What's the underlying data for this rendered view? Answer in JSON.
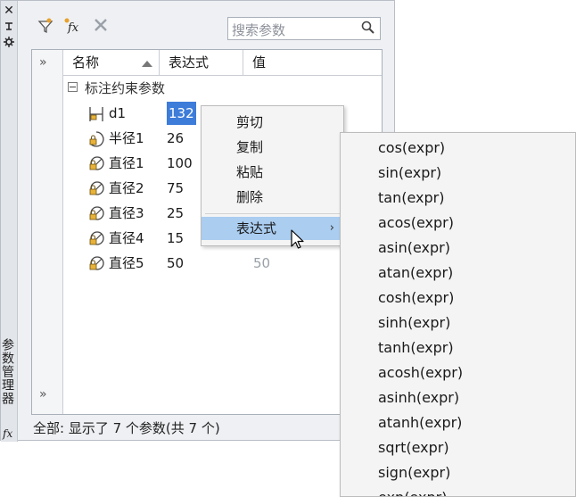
{
  "palette": {
    "vertical_title": "参数管理器",
    "titlebar_icons": [
      "close-icon",
      "pin-icon",
      "settings-icon"
    ],
    "search_placeholder": "搜索参数",
    "toolbar": [
      "new-user-parameter-icon",
      "fx-filter-icon",
      "delete-icon"
    ],
    "columns": [
      "名称",
      "表达式",
      "值"
    ],
    "group": "标注约束参数",
    "rows": [
      {
        "name": "d1",
        "expr": "132",
        "value": ""
      },
      {
        "name": "半径1",
        "expr": "26",
        "value": ""
      },
      {
        "name": "直径1",
        "expr": "100",
        "value": ""
      },
      {
        "name": "直径2",
        "expr": "75",
        "value": ""
      },
      {
        "name": "直径3",
        "expr": "25",
        "value": ""
      },
      {
        "name": "直径4",
        "expr": "15",
        "value": ""
      },
      {
        "name": "直径5",
        "expr": "50",
        "value": "50"
      }
    ],
    "expander_top": "»",
    "expander_bottom": "»",
    "status": "全部: 显示了 7 个参数(共 7 个)",
    "fx_label": "fx"
  },
  "context_menu": {
    "items": [
      "剪切",
      "复制",
      "粘贴",
      "删除",
      "表达式"
    ],
    "submenu_arrow": "›"
  },
  "submenu": {
    "items": [
      "cos(expr)",
      "sin(expr)",
      "tan(expr)",
      "acos(expr)",
      "asin(expr)",
      "atan(expr)",
      "cosh(expr)",
      "sinh(expr)",
      "tanh(expr)",
      "acosh(expr)",
      "asinh(expr)",
      "atanh(expr)",
      "sqrt(expr)",
      "sign(expr)",
      "exp(expr)"
    ]
  },
  "colors": {
    "selection": "#3d7cd9",
    "menu_highlight": "#aacdf0",
    "panel": "#eef0f3"
  }
}
